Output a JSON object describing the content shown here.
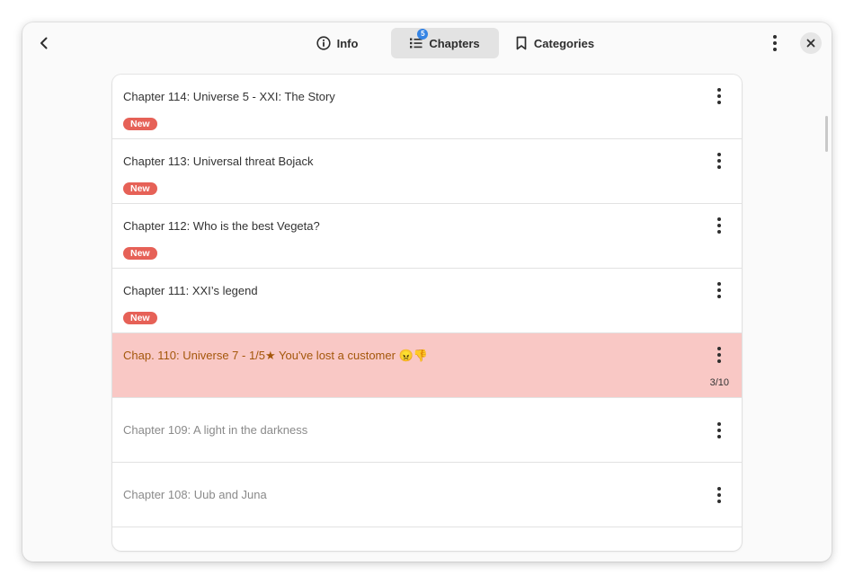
{
  "header": {
    "tabs": [
      {
        "label": "Info",
        "icon": "info-icon"
      },
      {
        "label": "Chapters",
        "icon": "list-icon",
        "badge": "5"
      },
      {
        "label": "Categories",
        "icon": "bookmark-icon"
      }
    ]
  },
  "chapters": [
    {
      "title": "Chapter 114: Universe 5 - XXI: The Story",
      "badge": "New"
    },
    {
      "title": "Chapter 113: Universal threat Bojack",
      "badge": "New"
    },
    {
      "title": "Chapter 112: Who is the best Vegeta?",
      "badge": "New"
    },
    {
      "title": "Chapter 111: XXI’s legend",
      "badge": "New"
    },
    {
      "title": "Chap. 110: Universe 7 - 1/5★ You've lost a customer 😠👎",
      "progress": "3/10"
    },
    {
      "title": "Chapter 109: A light in the darkness"
    },
    {
      "title": "Chapter 108: Uub and Juna"
    }
  ],
  "colors": {
    "accent": "#3584e4",
    "new_badge": "#e66157",
    "highlight_bg": "#f9c8c5",
    "highlight_text": "#a4570b"
  }
}
